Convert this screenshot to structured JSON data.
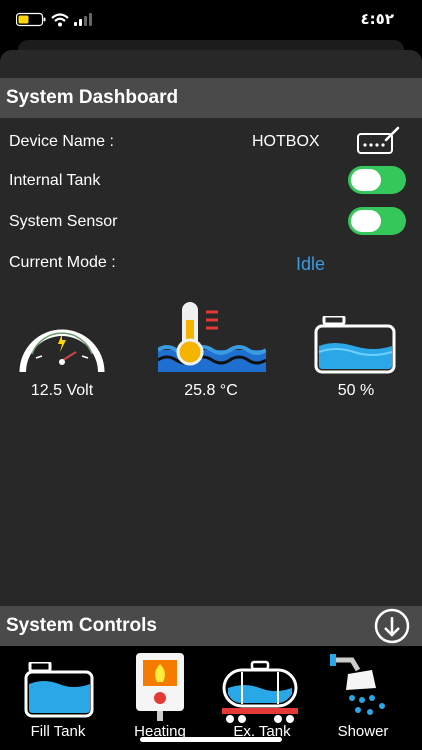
{
  "status_bar": {
    "time": "٤:٥٢"
  },
  "dashboard": {
    "title": "System Dashboard",
    "device_name_label": "Device Name :",
    "device_name_value": "HOTBOX",
    "internal_tank_label": "Internal Tank",
    "internal_tank_on": true,
    "system_sensor_label": "System Sensor",
    "system_sensor_on": true,
    "current_mode_label": "Current Mode :",
    "current_mode_value": "Idle"
  },
  "gauges": {
    "voltage": "12.5 Volt",
    "temperature": "25.8 °C",
    "tank_level": "50 %"
  },
  "controls": {
    "title": "System Controls",
    "buttons": [
      {
        "label": "Fill Tank"
      },
      {
        "label": "Heating"
      },
      {
        "label": "Ex. Tank"
      },
      {
        "label": "Shower"
      }
    ]
  },
  "colors": {
    "accent_blue": "#3b9be0",
    "toggle_green": "#35c759",
    "header_gray": "#4a4a4a",
    "panel_bg": "#282828"
  }
}
